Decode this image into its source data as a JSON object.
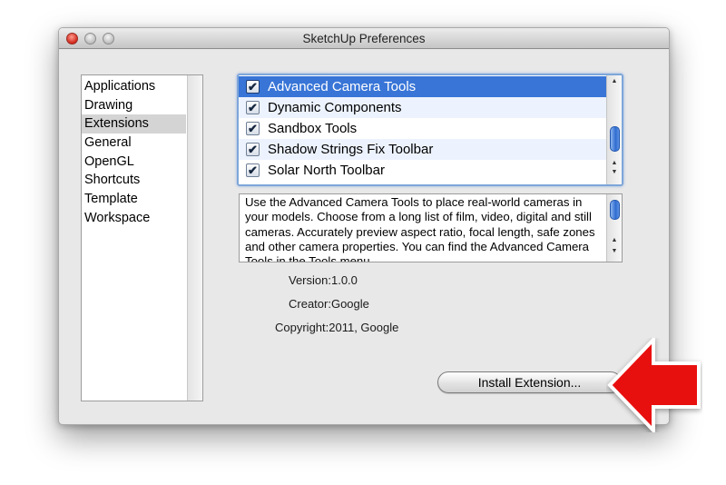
{
  "window": {
    "title": "SketchUp Preferences"
  },
  "sidebar": {
    "items": [
      {
        "label": "Applications",
        "selected": false
      },
      {
        "label": "Drawing",
        "selected": false
      },
      {
        "label": "Extensions",
        "selected": true
      },
      {
        "label": "General",
        "selected": false
      },
      {
        "label": "OpenGL",
        "selected": false
      },
      {
        "label": "Shortcuts",
        "selected": false
      },
      {
        "label": "Template",
        "selected": false
      },
      {
        "label": "Workspace",
        "selected": false
      }
    ]
  },
  "extensions": {
    "items": [
      {
        "label": "Advanced Camera Tools",
        "checked": true,
        "selected": true
      },
      {
        "label": "Dynamic Components",
        "checked": true,
        "selected": false
      },
      {
        "label": "Sandbox Tools",
        "checked": true,
        "selected": false
      },
      {
        "label": "Shadow Strings Fix Toolbar",
        "checked": true,
        "selected": false
      },
      {
        "label": "Solar North Toolbar",
        "checked": true,
        "selected": false
      }
    ],
    "check_glyph": "✔"
  },
  "details": {
    "description": "Use the Advanced Camera Tools to place real-world cameras in your models. Choose from a long list of film, video, digital and still cameras. Accurately preview aspect ratio, focal length, safe zones and other camera properties. You can find the Advanced Camera Tools in the Tools menu.",
    "version": "Version:1.0.0",
    "creator": "Creator:Google",
    "copyright": "Copyright:2011, Google"
  },
  "actions": {
    "install_label": "Install Extension..."
  },
  "colors": {
    "selection": "#3875d7",
    "arrow": "#e8100f",
    "close_button": "#d2271b"
  }
}
